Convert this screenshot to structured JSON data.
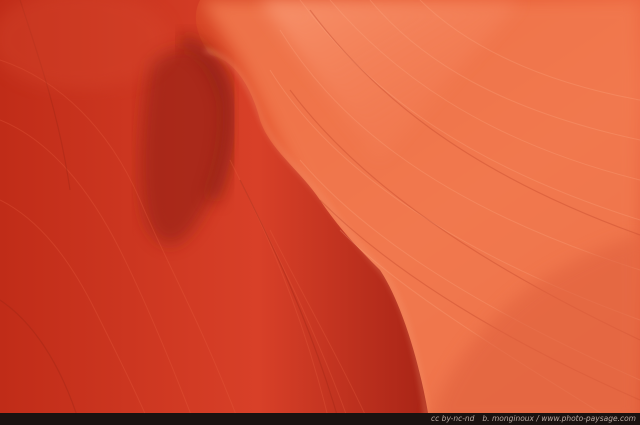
{
  "photo": {
    "subject": "Antelope canyon sandstone wave",
    "colors": {
      "deep": "#b82a18",
      "mid": "#e0502e",
      "light": "#f47a52",
      "glow": "#f89670",
      "shadow": "#8c1c10"
    }
  },
  "credits": {
    "license": "cc by-nc-nd",
    "author_site": "b. monginoux / www.photo-paysage.com"
  }
}
